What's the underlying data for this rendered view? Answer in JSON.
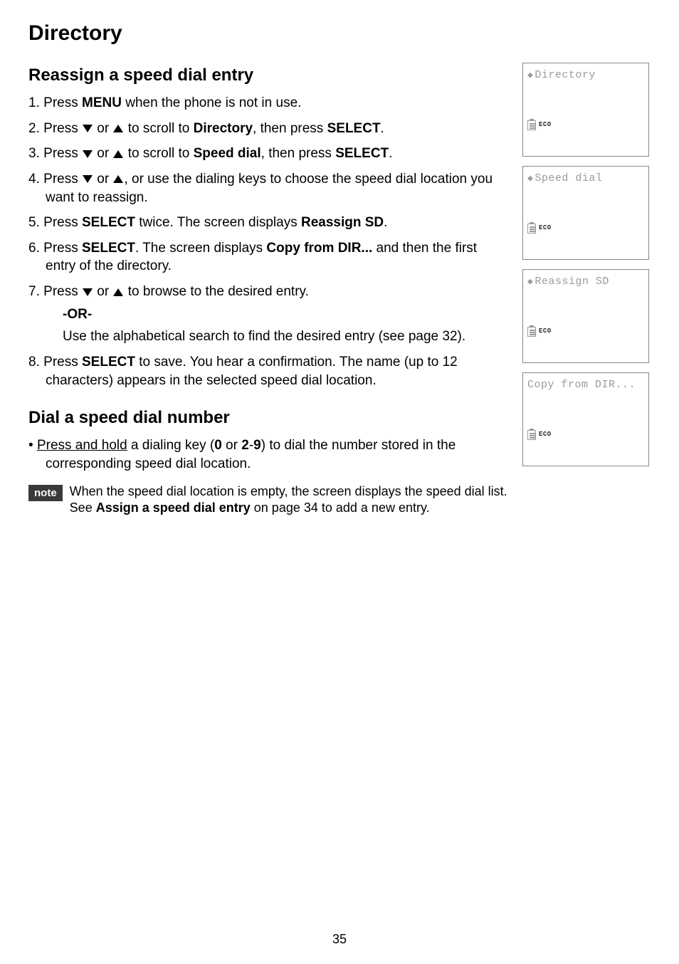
{
  "page_title": "Directory",
  "section1": {
    "title": "Reassign a speed dial entry",
    "step1_a": "Press ",
    "step1_menu": "MENU",
    "step1_b": " when the phone is not in use.",
    "step2_a": "Press ",
    "step2_b": " or ",
    "step2_c": " to scroll to ",
    "step2_dir": "Directory",
    "step2_d": ", then press ",
    "step2_select": "SELECT",
    "step2_e": ".",
    "step3_a": "Press ",
    "step3_b": " or ",
    "step3_c": " to scroll to ",
    "step3_sd": "Speed dial",
    "step3_d": ", then press ",
    "step3_select": "SELECT",
    "step3_e": ".",
    "step4_a": "Press ",
    "step4_b": " or ",
    "step4_c": ", or use the dialing keys to choose the speed dial location you want to reassign.",
    "step5_a": "Press ",
    "step5_select": "SELECT",
    "step5_b": " twice. The screen displays ",
    "step5_reassign": "Reassign SD",
    "step5_c": ".",
    "step6_a": "Press ",
    "step6_select": "SELECT",
    "step6_b": ". The screen displays ",
    "step6_copy": "Copy from DIR...",
    "step6_c": " and then the first entry of the directory.",
    "step7_a": "Press ",
    "step7_b": " or ",
    "step7_c": " to browse to the desired entry.",
    "or_label": "-OR-",
    "alpha_search": "Use the alphabetical search to find the desired entry (see page 32).",
    "step8_a": "Press ",
    "step8_select": "SELECT",
    "step8_b": " to save. You hear a confirmation. The name (up to 12 characters) appears in the selected speed dial location."
  },
  "section2": {
    "title": "Dial a speed dial number",
    "bullet_a": "Press and hold",
    "bullet_b": " a dialing key (",
    "bullet_zero": "0",
    "bullet_c": " or ",
    "bullet_range": "2",
    "bullet_dash": "-",
    "bullet_nine": "9",
    "bullet_d": ") to dial the number stored in the corresponding speed dial location."
  },
  "note": {
    "badge": "note",
    "line1": "When the speed dial location is empty, the screen displays the speed dial list.",
    "line2a": "See ",
    "line2_bold": "Assign a speed dial entry",
    "line2b": " on page 34 to add a new entry."
  },
  "lcds": {
    "eco": "ECO",
    "screen1": "Directory",
    "screen2": "Speed dial",
    "screen3": "Reassign SD",
    "screen4": "Copy from DIR..."
  },
  "page_number": "35"
}
